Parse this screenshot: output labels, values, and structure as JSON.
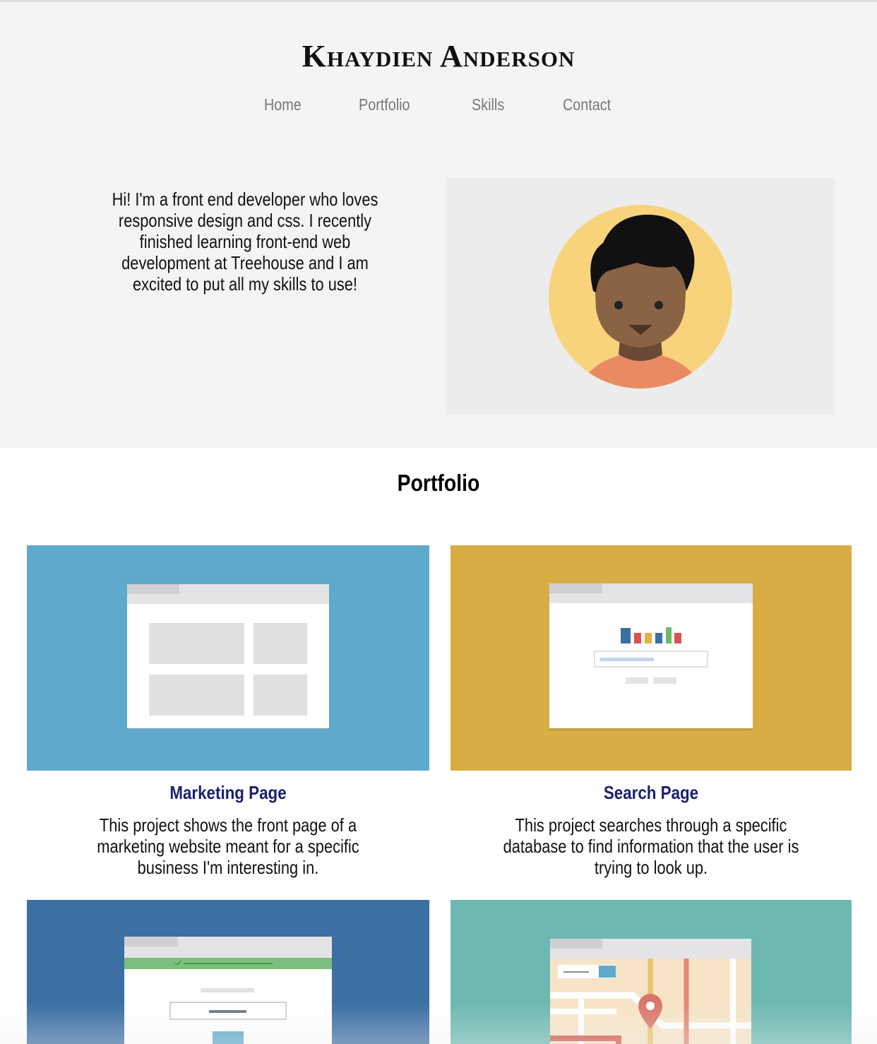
{
  "site": {
    "title": "Khaydien Anderson"
  },
  "nav": {
    "items": [
      "Home",
      "Portfolio",
      "Skills",
      "Contact"
    ]
  },
  "intro": {
    "text": "Hi! I'm a front end developer who loves responsive design and css. I recently finished learning front-end web development at Treehouse and I am excited to put all my skills to use!"
  },
  "portfolio": {
    "heading": "Portfolio",
    "projects": [
      {
        "title": "Marketing Page",
        "description": "This project shows the front page of a marketing website meant for a specific business I'm interesting in.",
        "bg_color": "#5eaacd",
        "icon": "layout-wireframe-icon"
      },
      {
        "title": "Search Page",
        "description": "This project searches through a specific database to find information that the user is trying to look up.",
        "bg_color": "#d9ad45",
        "icon": "search-page-icon"
      },
      {
        "title": "",
        "description": "",
        "bg_color": "#3c6fa3",
        "icon": "form-page-icon"
      },
      {
        "title": "",
        "description": "",
        "bg_color": "#6db9b2",
        "icon": "map-icon"
      }
    ]
  },
  "colors": {
    "header_bg": "#f4f4f4",
    "title_link": "#1a1f6e",
    "nav_text": "#777777"
  }
}
